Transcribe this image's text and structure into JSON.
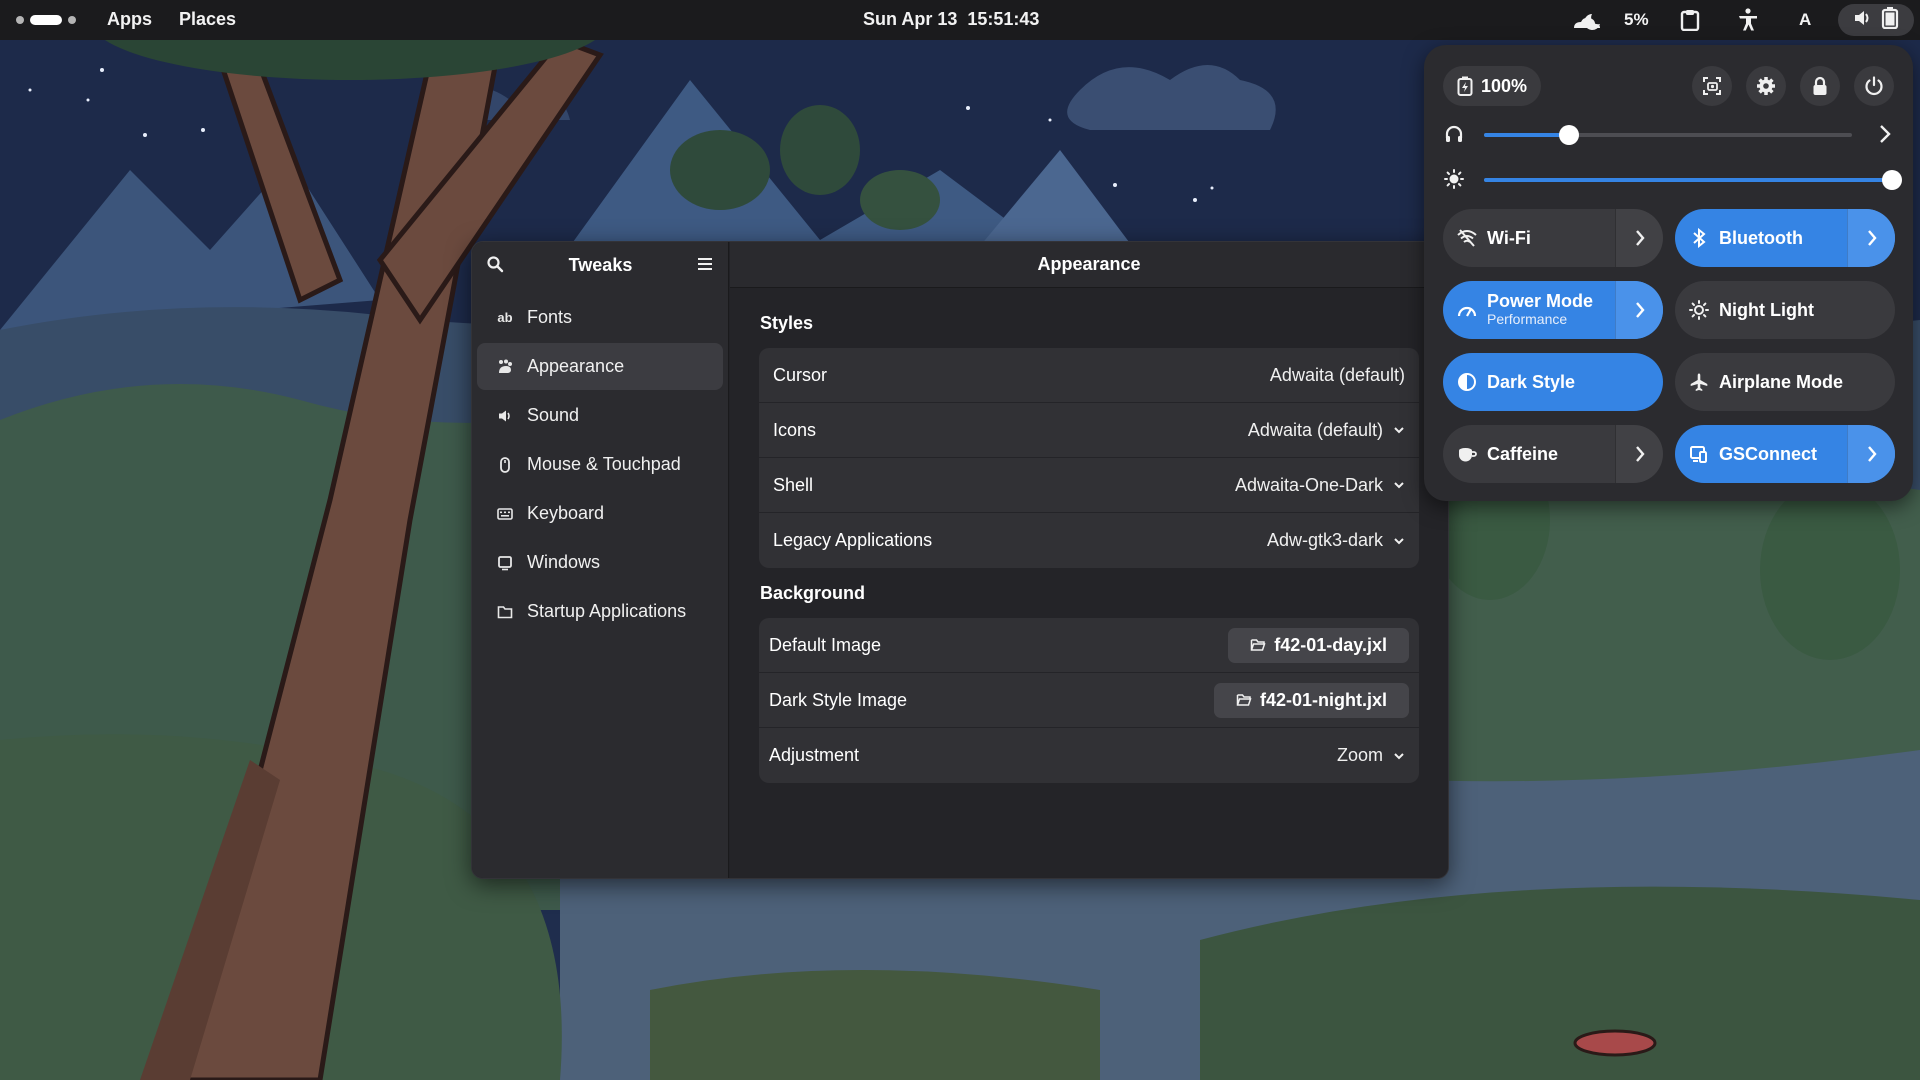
{
  "topbar": {
    "apps_label": "Apps",
    "places_label": "Places",
    "date": "Sun Apr 13",
    "time": "15:51:43",
    "weather_icon": "weather-night-cloudy-icon",
    "weather_percent": "5%",
    "keyboard_layout": "A"
  },
  "tweaks": {
    "sidebar_title": "Tweaks",
    "sidebar_items": [
      {
        "label": "Fonts",
        "icon": "fonts-icon"
      },
      {
        "label": "Appearance",
        "icon": "appearance-icon",
        "active": true
      },
      {
        "label": "Sound",
        "icon": "speaker-icon"
      },
      {
        "label": "Mouse & Touchpad",
        "icon": "mouse-icon"
      },
      {
        "label": "Keyboard",
        "icon": "keyboard-icon"
      },
      {
        "label": "Windows",
        "icon": "window-icon"
      },
      {
        "label": "Startup Applications",
        "icon": "folder-icon"
      }
    ],
    "content_title": "Appearance",
    "styles_title": "Styles",
    "styles_rows": [
      {
        "label": "Cursor",
        "value": "Adwaita (default)"
      },
      {
        "label": "Icons",
        "value": "Adwaita (default)"
      },
      {
        "label": "Shell",
        "value": "Adwaita-One-Dark"
      },
      {
        "label": "Legacy Applications",
        "value": "Adw-gtk3-dark"
      }
    ],
    "background_title": "Background",
    "background_rows": [
      {
        "label": "Default Image",
        "value": "f42-01-day.jxl"
      },
      {
        "label": "Dark Style Image",
        "value": "f42-01-night.jxl"
      },
      {
        "label": "Adjustment",
        "value": "Zoom"
      }
    ]
  },
  "quick_settings": {
    "battery": "100%",
    "volume_level": 0.23,
    "brightness_level": 1.0,
    "tiles": [
      {
        "label": "Wi-Fi",
        "on": false,
        "arrow": true
      },
      {
        "label": "Bluetooth",
        "on": true,
        "arrow": true
      },
      {
        "label": "Power Mode",
        "sub": "Performance",
        "on": true,
        "arrow": true
      },
      {
        "label": "Night Light",
        "on": false,
        "arrow": false
      },
      {
        "label": "Dark Style",
        "on": true,
        "arrow": false
      },
      {
        "label": "Airplane Mode",
        "on": false,
        "arrow": false
      },
      {
        "label": "Caffeine",
        "on": false,
        "arrow": true
      },
      {
        "label": "GSConnect",
        "on": true,
        "arrow": true
      }
    ]
  },
  "colors": {
    "accent": "#3584e4",
    "panel": "#1b1b1d",
    "window_bg": "#242428"
  }
}
